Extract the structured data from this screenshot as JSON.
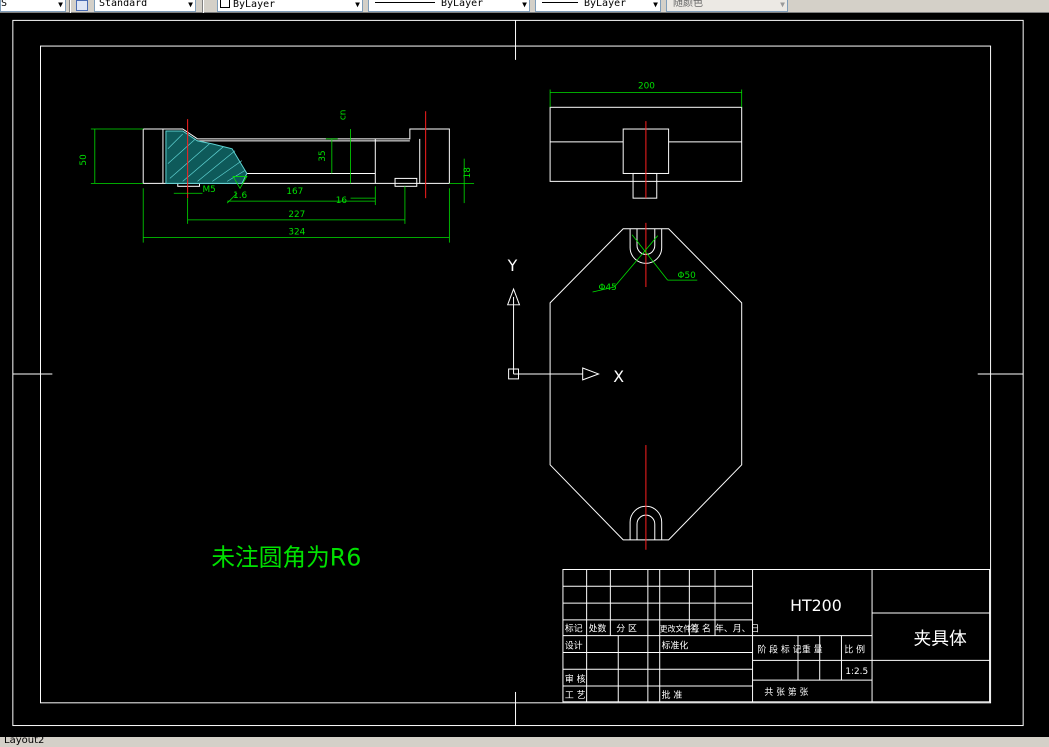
{
  "toolbar": {
    "style_value": "Standard",
    "layer_value": "ByLayer",
    "linetype_value": "ByLayer",
    "lineweight_value": "ByLayer",
    "color_value": "随颜色",
    "cut_prefix": "S"
  },
  "drawing": {
    "note": "未注圆角为R6",
    "front_view_dims": {
      "d_324": "324",
      "d_227": "227",
      "d_167": "167",
      "d_50": "50",
      "d_35": "35",
      "d_16": "16",
      "d_m5": "M5",
      "d_1_6": "1.6",
      "d_18": "18",
      "d_cn": "cn"
    },
    "side_view_dim": "200",
    "top_view": {
      "dia_45": "Φ45",
      "dia_50": "Φ50",
      "axis_x": "X",
      "axis_y": "Y"
    }
  },
  "title_block": {
    "material": "HT200",
    "part_name": "夹具体",
    "scale": "1:2.5",
    "headers": [
      "标记",
      "处数",
      "分 区",
      "更改文件号",
      "签 名",
      "年、月、日"
    ],
    "design": "设计",
    "standardize": "标准化",
    "stage_mark": "阶 段 标 记",
    "weight": "重 量",
    "ratio": "比 例",
    "review": "审 核",
    "process": "工 艺",
    "approve": "批 准",
    "sheets": "共   张   第   张"
  },
  "layout_tab": "Layout2"
}
